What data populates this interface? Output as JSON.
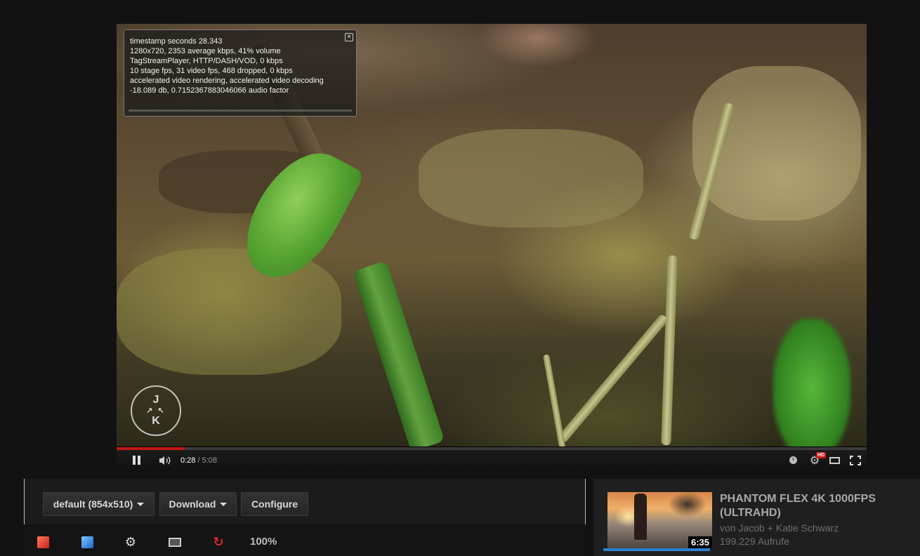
{
  "stats": {
    "lines": [
      "timestamp seconds 28.343",
      "1280x720, 2353 average kbps, 41% volume",
      "TagStreamPlayer, HTTP/DASH/VOD, 0 kbps",
      "10 stage fps, 31 video fps, 468 dropped, 0 kbps",
      "accelerated video rendering, accelerated video decoding",
      "-18.089 db, 0.7152367883046066 audio factor"
    ],
    "close_glyph": "×"
  },
  "logo": {
    "top": "J",
    "bottom": "K",
    "arrows": "↗ ↖"
  },
  "player": {
    "current_time": "0:28",
    "separator": " / ",
    "duration": "5:08",
    "progress_fraction": 0.0909,
    "hd_badge": "HD",
    "accent_color": "#c4191b"
  },
  "toolbar": {
    "size_label": "default (854x510)",
    "download_label": "Download",
    "configure_label": "Configure",
    "zoom": "100%"
  },
  "related": {
    "title": "PHANTOM FLEX 4K 1000FPS (ULTRAHD)",
    "author": "von Jacob + Katie Schwarz",
    "views": "199.229 Aufrufe",
    "duration": "6:35"
  },
  "icons": {
    "play_pause": "pause-icon",
    "volume": "volume-icon",
    "watch_later": "clock-icon",
    "settings": "gear-icon",
    "theater": "theater-mode-icon",
    "fullscreen": "fullscreen-icon",
    "row": [
      "red-wand-icon",
      "blue-wand-icon",
      "gear-icon",
      "screen-icon",
      "reload-icon"
    ]
  }
}
